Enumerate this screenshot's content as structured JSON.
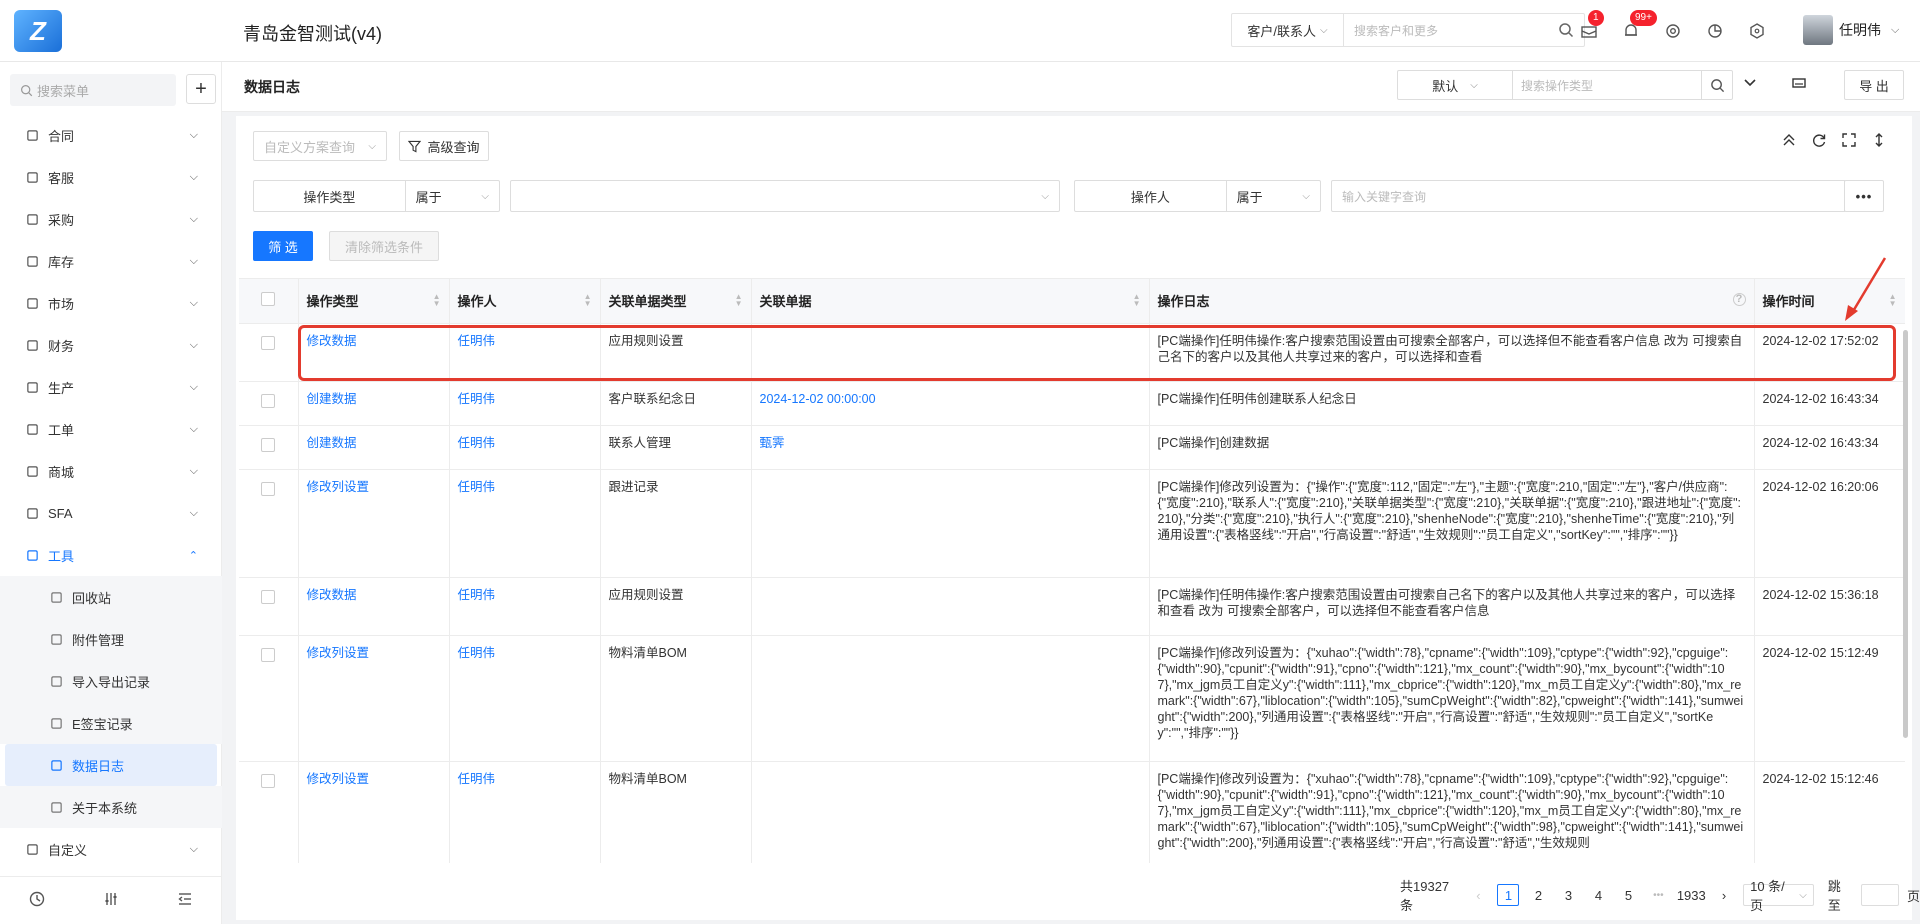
{
  "app": {
    "title": "青岛金智测试(v4)"
  },
  "top_search": {
    "scope": "客户/联系人",
    "placeholder": "搜索客户和更多"
  },
  "notifications": {
    "mail_count": "1",
    "bell_count": "99+"
  },
  "user": {
    "name": "任明伟"
  },
  "sidebar": {
    "search_placeholder": "搜索菜单",
    "items": [
      {
        "label": "合同",
        "icon": "contract-icon"
      },
      {
        "label": "客服",
        "icon": "headset-icon"
      },
      {
        "label": "采购",
        "icon": "cart-icon"
      },
      {
        "label": "库存",
        "icon": "warehouse-icon"
      },
      {
        "label": "市场",
        "icon": "market-icon"
      },
      {
        "label": "财务",
        "icon": "finance-icon"
      },
      {
        "label": "生产",
        "icon": "factory-icon"
      },
      {
        "label": "工单",
        "icon": "ticket-icon"
      },
      {
        "label": "商城",
        "icon": "shop-icon"
      },
      {
        "label": "SFA",
        "icon": "sfa-icon"
      },
      {
        "label": "工具",
        "icon": "tool-icon"
      }
    ],
    "sub_items": [
      {
        "label": "回收站",
        "icon": "trash-icon"
      },
      {
        "label": "附件管理",
        "icon": "paperclip-icon"
      },
      {
        "label": "导入导出记录",
        "icon": "import-export-icon"
      },
      {
        "label": "E签宝记录",
        "icon": "esign-icon"
      },
      {
        "label": "数据日志",
        "icon": "log-icon"
      },
      {
        "label": "关于本系统",
        "icon": "info-icon"
      }
    ],
    "last_item": {
      "label": "自定义",
      "icon": "grid-icon"
    }
  },
  "page": {
    "title": "数据日志",
    "view_select": "默认",
    "search_placeholder": "搜索操作类型",
    "export_label": "导 出"
  },
  "filters": {
    "scheme_placeholder": "自定义方案查询",
    "advanced_label": "高级查询",
    "field1_label": "操作类型",
    "field1_op": "属于",
    "field2_label": "操作人",
    "field2_op": "属于",
    "keyword_placeholder": "输入关键字查询",
    "filter_btn": "筛 选",
    "clear_btn": "清除筛选条件"
  },
  "table": {
    "columns": [
      "操作类型",
      "操作人",
      "关联单据类型",
      "关联单据",
      "操作日志",
      "操作时间"
    ],
    "rows": [
      {
        "type": "修改数据",
        "operator": "任明伟",
        "doc_type": "应用规则设置",
        "doc": "",
        "log": "[PC端操作]任明伟操作:客户搜索范围设置由可搜索全部客户，可以选择但不能查看客户信息 改为 可搜索自己名下的客户以及其他人共享过来的客户，可以选择和查看",
        "time": "2024-12-02 17:52:02"
      },
      {
        "type": "创建数据",
        "operator": "任明伟",
        "doc_type": "客户联系纪念日",
        "doc": "2024-12-02 00:00:00",
        "log": "[PC端操作]任明伟创建联系人纪念日",
        "time": "2024-12-02 16:43:34"
      },
      {
        "type": "创建数据",
        "operator": "任明伟",
        "doc_type": "联系人管理",
        "doc": "甄霁",
        "log": "[PC端操作]创建数据",
        "time": "2024-12-02 16:43:34"
      },
      {
        "type": "修改列设置",
        "operator": "任明伟",
        "doc_type": "跟进记录",
        "doc": "",
        "log": "[PC端操作]修改列设置为：{\"操作\":{\"宽度\":112,\"固定\":\"左\"},\"主题\":{\"宽度\":210,\"固定\":\"左\"},\"客户/供应商\":{\"宽度\":210},\"联系人\":{\"宽度\":210},\"关联单据类型\":{\"宽度\":210},\"关联单据\":{\"宽度\":210},\"跟进地址\":{\"宽度\":210},\"分类\":{\"宽度\":210},\"执行人\":{\"宽度\":210},\"shenheNode\":{\"宽度\":210},\"shenheTime\":{\"宽度\":210},\"列通用设置\":{\"表格竖线\":\"开启\",\"行高设置\":\"舒适\",\"生效规则\":\"员工自定义\",\"sortKey\":\"\",\"排序\":\"\"}}",
        "time": "2024-12-02 16:20:06"
      },
      {
        "type": "修改数据",
        "operator": "任明伟",
        "doc_type": "应用规则设置",
        "doc": "",
        "log": "[PC端操作]任明伟操作:客户搜索范围设置由可搜索自己名下的客户以及其他人共享过来的客户，可以选择和查看 改为 可搜索全部客户，可以选择但不能查看客户信息",
        "time": "2024-12-02 15:36:18"
      },
      {
        "type": "修改列设置",
        "operator": "任明伟",
        "doc_type": "物料清单BOM",
        "doc": "",
        "log": "[PC端操作]修改列设置为：{\"xuhao\":{\"width\":78},\"cpname\":{\"width\":109},\"cptype\":{\"width\":92},\"cpguige\":{\"width\":90},\"cpunit\":{\"width\":91},\"cpno\":{\"width\":121},\"mx_count\":{\"width\":90},\"mx_bycount\":{\"width\":107},\"mx_jgm员工自定义y\":{\"width\":111},\"mx_cbprice\":{\"width\":120},\"mx_m员工自定义y\":{\"width\":80},\"mx_remark\":{\"width\":67},\"liblocation\":{\"width\":105},\"sumCpWeight\":{\"width\":82},\"cpweight\":{\"width\":141},\"sumweight\":{\"width\":200},\"列通用设置\":{\"表格竖线\":\"开启\",\"行高设置\":\"舒适\",\"生效规则\":\"员工自定义\",\"sortKey\":\"\",\"排序\":\"\"}}",
        "time": "2024-12-02 15:12:49"
      },
      {
        "type": "修改列设置",
        "operator": "任明伟",
        "doc_type": "物料清单BOM",
        "doc": "",
        "log": "[PC端操作]修改列设置为：{\"xuhao\":{\"width\":78},\"cpname\":{\"width\":109},\"cptype\":{\"width\":92},\"cpguige\":{\"width\":90},\"cpunit\":{\"width\":91},\"cpno\":{\"width\":121},\"mx_count\":{\"width\":90},\"mx_bycount\":{\"width\":107},\"mx_jgm员工自定义y\":{\"width\":111},\"mx_cbprice\":{\"width\":120},\"mx_m员工自定义y\":{\"width\":80},\"mx_remark\":{\"width\":67},\"liblocation\":{\"width\":105},\"sumCpWeight\":{\"width\":98},\"cpweight\":{\"width\":141},\"sumweight\":{\"width\":200},\"列通用设置\":{\"表格竖线\":\"开启\",\"行高设置\":\"舒适\",\"生效规则",
        "time": "2024-12-02 15:12:46"
      }
    ]
  },
  "pagination": {
    "total": "共19327条",
    "pages": [
      "1",
      "2",
      "3",
      "4",
      "5"
    ],
    "ellipsis": "•••",
    "last": "1933",
    "page_size": "10 条/页",
    "jump_label": "跳至",
    "page_suffix": "页"
  },
  "colors": {
    "primary": "#1677ff",
    "highlight": "#e33b2e"
  }
}
